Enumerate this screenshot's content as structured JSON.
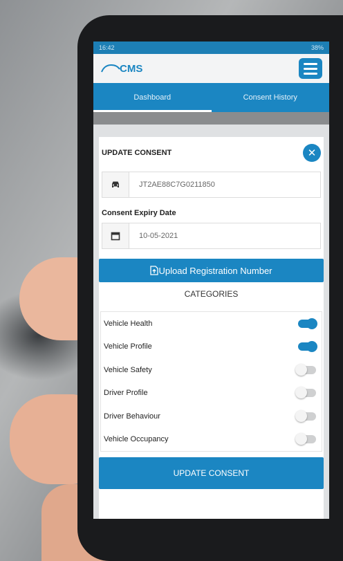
{
  "status_bar": {
    "time": "16:42",
    "right": "38%"
  },
  "header": {
    "logo_text": "CMS"
  },
  "tabs": [
    {
      "label": "Dashboard"
    },
    {
      "label": "Consent History"
    }
  ],
  "modal": {
    "title": "UPDATE CONSENT",
    "vin_value": "JT2AE88C7G0211850",
    "expiry_label": "Consent Expiry Date",
    "expiry_value": "10-05-2021",
    "upload_label": "Upload Registration Number",
    "categories_heading": "CATEGORIES",
    "categories": [
      {
        "label": "Vehicle Health",
        "enabled": true
      },
      {
        "label": "Vehicle Profile",
        "enabled": true
      },
      {
        "label": "Vehicle Safety",
        "enabled": false
      },
      {
        "label": "Driver Profile",
        "enabled": false
      },
      {
        "label": "Driver Behaviour",
        "enabled": false
      },
      {
        "label": "Vehicle Occupancy",
        "enabled": false
      }
    ],
    "submit_label": "UPDATE CONSENT"
  },
  "colors": {
    "accent": "#1b86c2"
  }
}
